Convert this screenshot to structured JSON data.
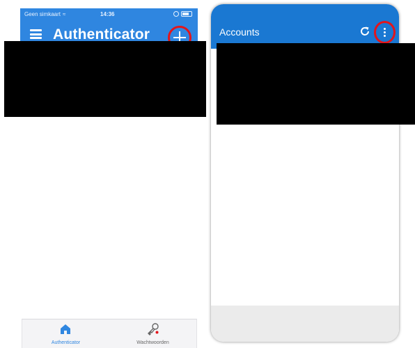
{
  "left_phone": {
    "status_bar": {
      "carrier": "Geen simkaart",
      "time": "14:36"
    },
    "header": {
      "title": "Authenticator",
      "add_icon": "plus-icon",
      "menu_icon": "hamburger-menu-icon"
    },
    "tabs": [
      {
        "label": "Authenticator",
        "icon": "home-icon",
        "active": true
      },
      {
        "label": "Wachtwoorden",
        "icon": "key-icon",
        "active": false
      }
    ]
  },
  "right_phone": {
    "header": {
      "title": "Accounts",
      "refresh_icon": "refresh-icon",
      "more_icon": "more-vertical-icon"
    }
  },
  "colors": {
    "ios_header": "#2f86e0",
    "android_header": "#1a78d2",
    "highlight_circle": "#e3151b",
    "redaction": "#000000"
  }
}
